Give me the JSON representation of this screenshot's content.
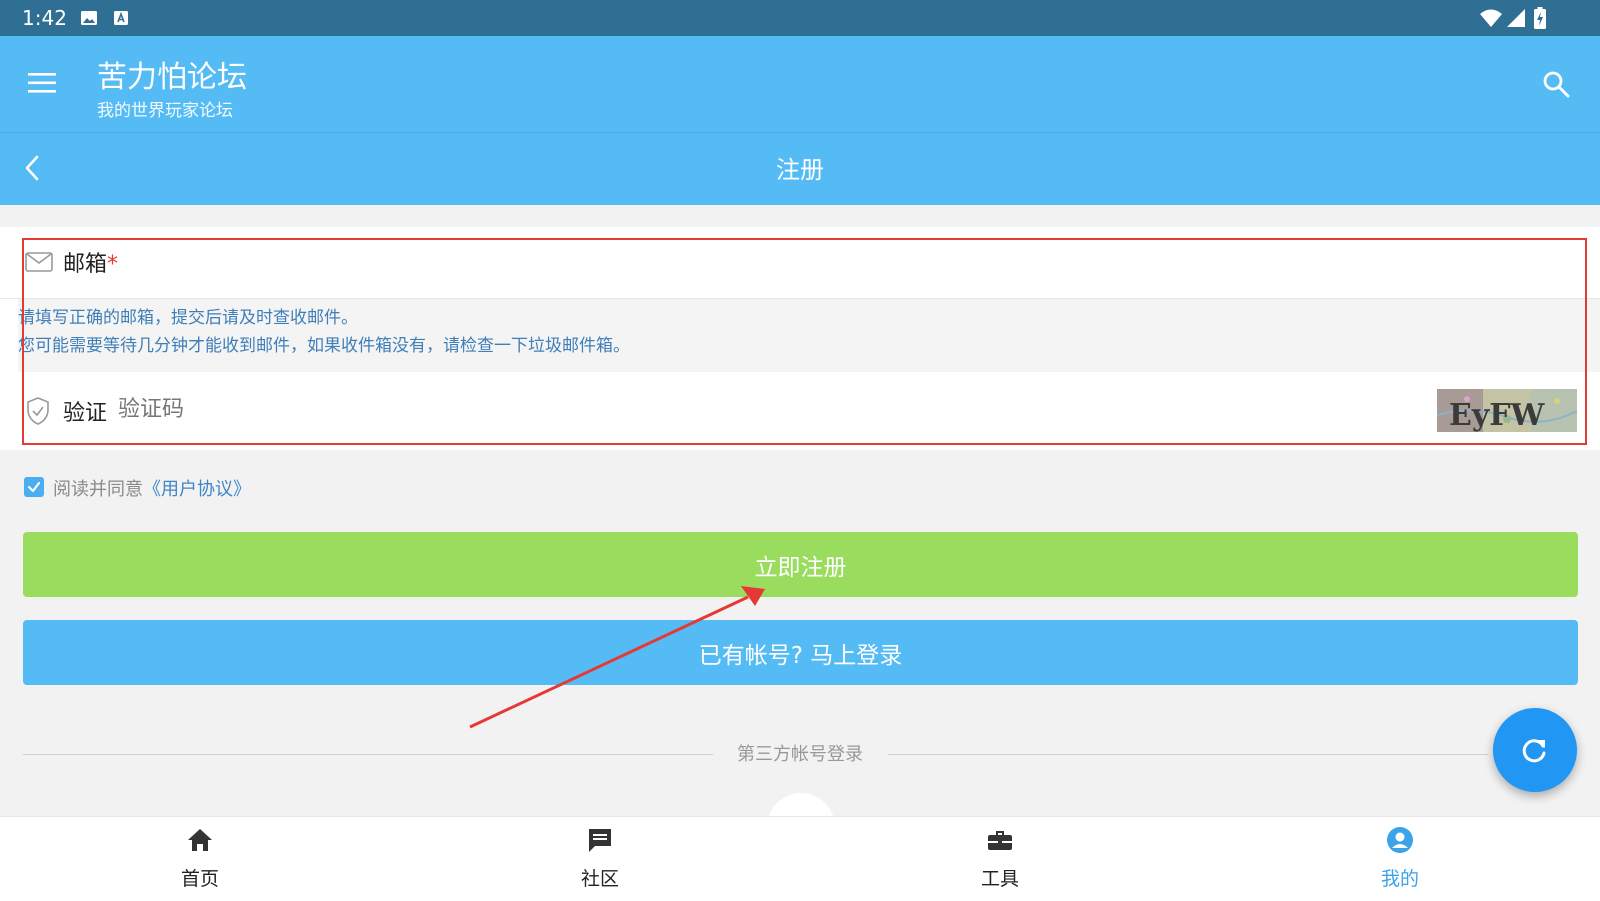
{
  "status_bar": {
    "time": "1:42",
    "icons": [
      "image-icon",
      "text-a-icon",
      "wifi-icon",
      "signal-icon",
      "battery-icon"
    ]
  },
  "app_bar": {
    "title": "苦力怕论坛",
    "subtitle": "我的世界玩家论坛",
    "icons": [
      "menu-icon",
      "search-icon"
    ]
  },
  "page": {
    "title": "注册"
  },
  "form": {
    "email_label": "邮箱",
    "email_required": "*",
    "hint_line1": "请填写正确的邮箱，提交后请及时查收邮件。",
    "hint_line2": "您可能需要等待几分钟才能收到邮件，如果收件箱没有，请检查一下垃圾邮件箱。",
    "verify_label": "验证",
    "captcha_placeholder": "验证码",
    "captcha_text": "EyFW"
  },
  "agreement": {
    "checked": true,
    "text": "阅读并同意",
    "link": "《用户协议》"
  },
  "buttons": {
    "register": "立即注册",
    "login": "已有帐号? 马上登录"
  },
  "third_party": {
    "label": "第三方帐号登录"
  },
  "bottom_nav": {
    "items": [
      {
        "label": "首页",
        "icon": "home-icon",
        "active": false
      },
      {
        "label": "社区",
        "icon": "chat-icon",
        "active": false
      },
      {
        "label": "工具",
        "icon": "toolbox-icon",
        "active": false
      },
      {
        "label": "我的",
        "icon": "account-icon",
        "active": true
      }
    ]
  },
  "colors": {
    "status_bar": "#2f6f93",
    "app_bar": "#55bbf5",
    "register_button": "#99dc5e",
    "login_button": "#55bbf5",
    "fab": "#2196f3",
    "annotation": "#e53935",
    "nav_active": "#3da3e8"
  }
}
